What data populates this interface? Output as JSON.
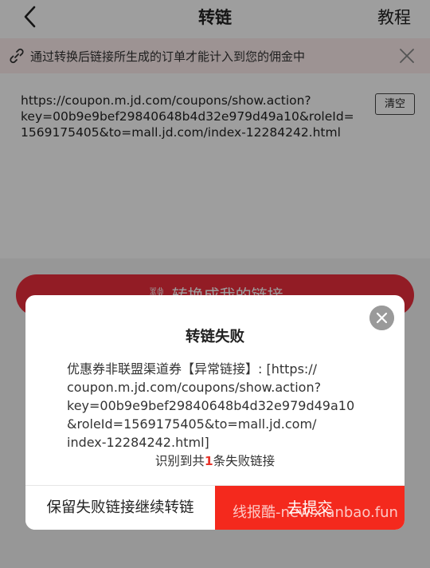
{
  "navbar": {
    "title": "转链",
    "right_label": "教程"
  },
  "notice": {
    "text": "通过转换后链接所生成的订单才能计入到您的佣金中"
  },
  "url_input": {
    "lines": [
      "https://coupon.m.jd.com/coupons/show.action?",
      "key=00b9e9bef29840648b4d32e979d49a10&roleId=",
      "1569175405&to=mall.jd.com/index-12284242.html"
    ],
    "clear_label": "清空"
  },
  "convert_button": {
    "label": "转换成我的链接"
  },
  "dialog": {
    "title": "转链失败",
    "body_lines": [
      "优惠券非联盟渠道券【异常链接】: [https://",
      "coupon.m.jd.com/coupons/show.action?",
      "key=00b9e9bef29840648b4d32e979d49a10",
      "&roleId=1569175405&to=mall.jd.com/",
      "index-12284242.html]"
    ],
    "count_prefix": "识别到共",
    "count_value": "1",
    "count_suffix": "条失败链接",
    "keep_button": "保留失败链接继续转链",
    "submit_button": "去提交"
  },
  "watermark": "线报酷-new.xianbao.fun",
  "colors": {
    "accent_red": "#f4291d",
    "convert_red": "#ec2e3c",
    "notice_bg": "#fdeeee"
  }
}
